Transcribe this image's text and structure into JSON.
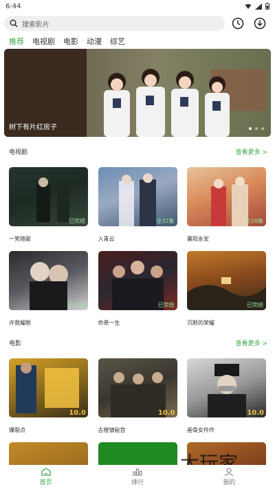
{
  "status_bar": {
    "time": "6:44"
  },
  "search": {
    "placeholder": "搜索影片"
  },
  "header_icons": [
    "search-icon",
    "history-icon",
    "download-icon"
  ],
  "tabs": [
    {
      "label": "推荐",
      "active": true
    },
    {
      "label": "电视剧",
      "active": false
    },
    {
      "label": "电影",
      "active": false
    },
    {
      "label": "动漫",
      "active": false
    },
    {
      "label": "综艺",
      "active": false
    }
  ],
  "banner": {
    "caption": "树下有片红房子",
    "dots": 3,
    "active_dot": 0
  },
  "sections": [
    {
      "title": "电视剧",
      "more": "查看更多 >",
      "rows": [
        [
          {
            "title": "一笑随歌",
            "badge": "已完结"
          },
          {
            "title": "入青云",
            "badge": "全32集"
          },
          {
            "title": "襄阳永安",
            "badge": "全28集"
          }
        ],
        [
          {
            "title": "许我耀眼",
            "badge": "全32集"
          },
          {
            "title": "命悬一生",
            "badge": "已完结"
          },
          {
            "title": "沉默的荣耀",
            "badge": "已完结"
          }
        ]
      ]
    },
    {
      "title": "电影",
      "more": "查看更多 >",
      "rows": [
        [
          {
            "title": "爆裂点",
            "score": "10.0"
          },
          {
            "title": "古橙镇秘宫",
            "score": "10.0"
          },
          {
            "title": "画骨女仵作",
            "score": "10.0"
          }
        ]
      ]
    }
  ],
  "bottom_nav": [
    {
      "label": "首页",
      "icon": "home-icon",
      "active": true
    },
    {
      "label": "排行",
      "icon": "ranking-icon",
      "active": false
    },
    {
      "label": "我的",
      "icon": "profile-icon",
      "active": false
    }
  ],
  "watermark": "大玩家",
  "colors": {
    "accent": "#3aa84a"
  }
}
